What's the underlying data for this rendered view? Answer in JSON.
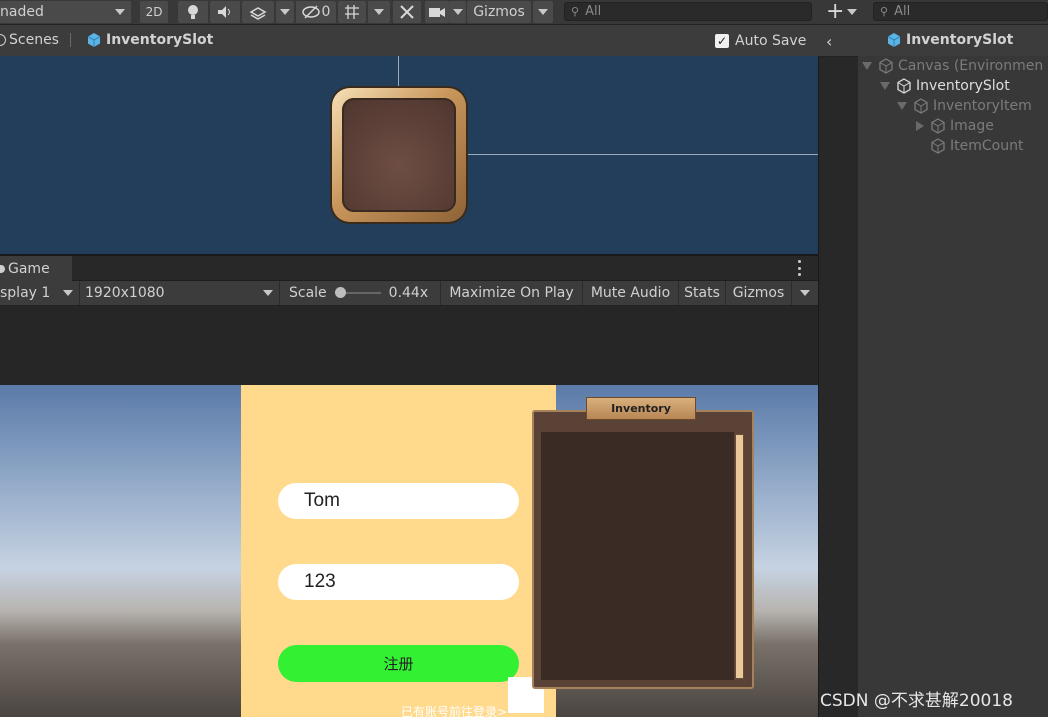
{
  "toolbar": {
    "shading_mode": "naded",
    "btn_2d": "2D",
    "hidden_count": "0",
    "gizmos": "Gizmos",
    "search_placeholder": "All"
  },
  "scene_tabs": {
    "scenes": "Scenes",
    "prefab": "InventorySlot",
    "auto_save": "Auto Save"
  },
  "game_tab": {
    "label": "Game"
  },
  "game_bar": {
    "display": "splay 1",
    "resolution": "1920x1080",
    "scale_label": "Scale",
    "scale_value": "0.44x",
    "maximize": "Maximize On Play",
    "mute": "Mute Audio",
    "stats": "Stats",
    "gizmos": "Gizmos"
  },
  "game_view": {
    "username_value": "Tom",
    "password_value": "123",
    "register_button": "注册",
    "login_link": "已有账号前往登录>",
    "inventory_title": "Inventory",
    "colors": {
      "panel": "#ffd98c",
      "register": "#33f033"
    }
  },
  "hierarchy": {
    "search_placeholder": "All",
    "header": "InventorySlot",
    "items": [
      {
        "label": "Canvas (Environmen",
        "dim": true
      },
      {
        "label": "InventorySlot",
        "dim": false
      },
      {
        "label": "InventoryItem",
        "dim": true
      },
      {
        "label": "Image",
        "dim": true
      },
      {
        "label": "ItemCount",
        "dim": true
      }
    ]
  },
  "watermark": "CSDN @不求甚解20018"
}
